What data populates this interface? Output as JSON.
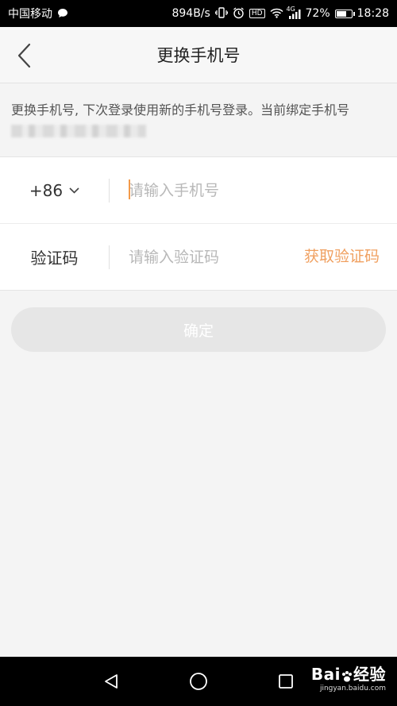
{
  "status_bar": {
    "carrier": "中国移动",
    "speed": "894B/s",
    "signal_label": "4G",
    "battery_percent": "72%",
    "battery_level": 0.72,
    "time": "18:28",
    "icons": [
      "chat-bubble-icon",
      "vibrate-icon",
      "alarm-icon",
      "hd-icon",
      "wifi-icon",
      "signal-icon",
      "battery-icon"
    ]
  },
  "header": {
    "title": "更换手机号",
    "back_icon": "chevron-left-icon"
  },
  "description": {
    "text": "更换手机号, 下次登录使用新的手机号登录。当前绑定手机号"
  },
  "form": {
    "country_code": "+86",
    "phone_placeholder": "请输入手机号",
    "code_label": "验证码",
    "code_placeholder": "请输入验证码",
    "get_code_label": "获取验证码"
  },
  "confirm_button": {
    "label": "确定"
  },
  "system_nav": {
    "icons": [
      "back-triangle-icon",
      "home-circle-icon",
      "recents-square-icon"
    ]
  },
  "watermark": {
    "brand": "Bai",
    "brand_suffix": "经验",
    "url": "jingyan.baidu.com"
  },
  "colors": {
    "accent": "#f0a060",
    "cursor": "#f39a4a",
    "button_disabled": "#e6e6e6",
    "background": "#f4f4f4"
  }
}
